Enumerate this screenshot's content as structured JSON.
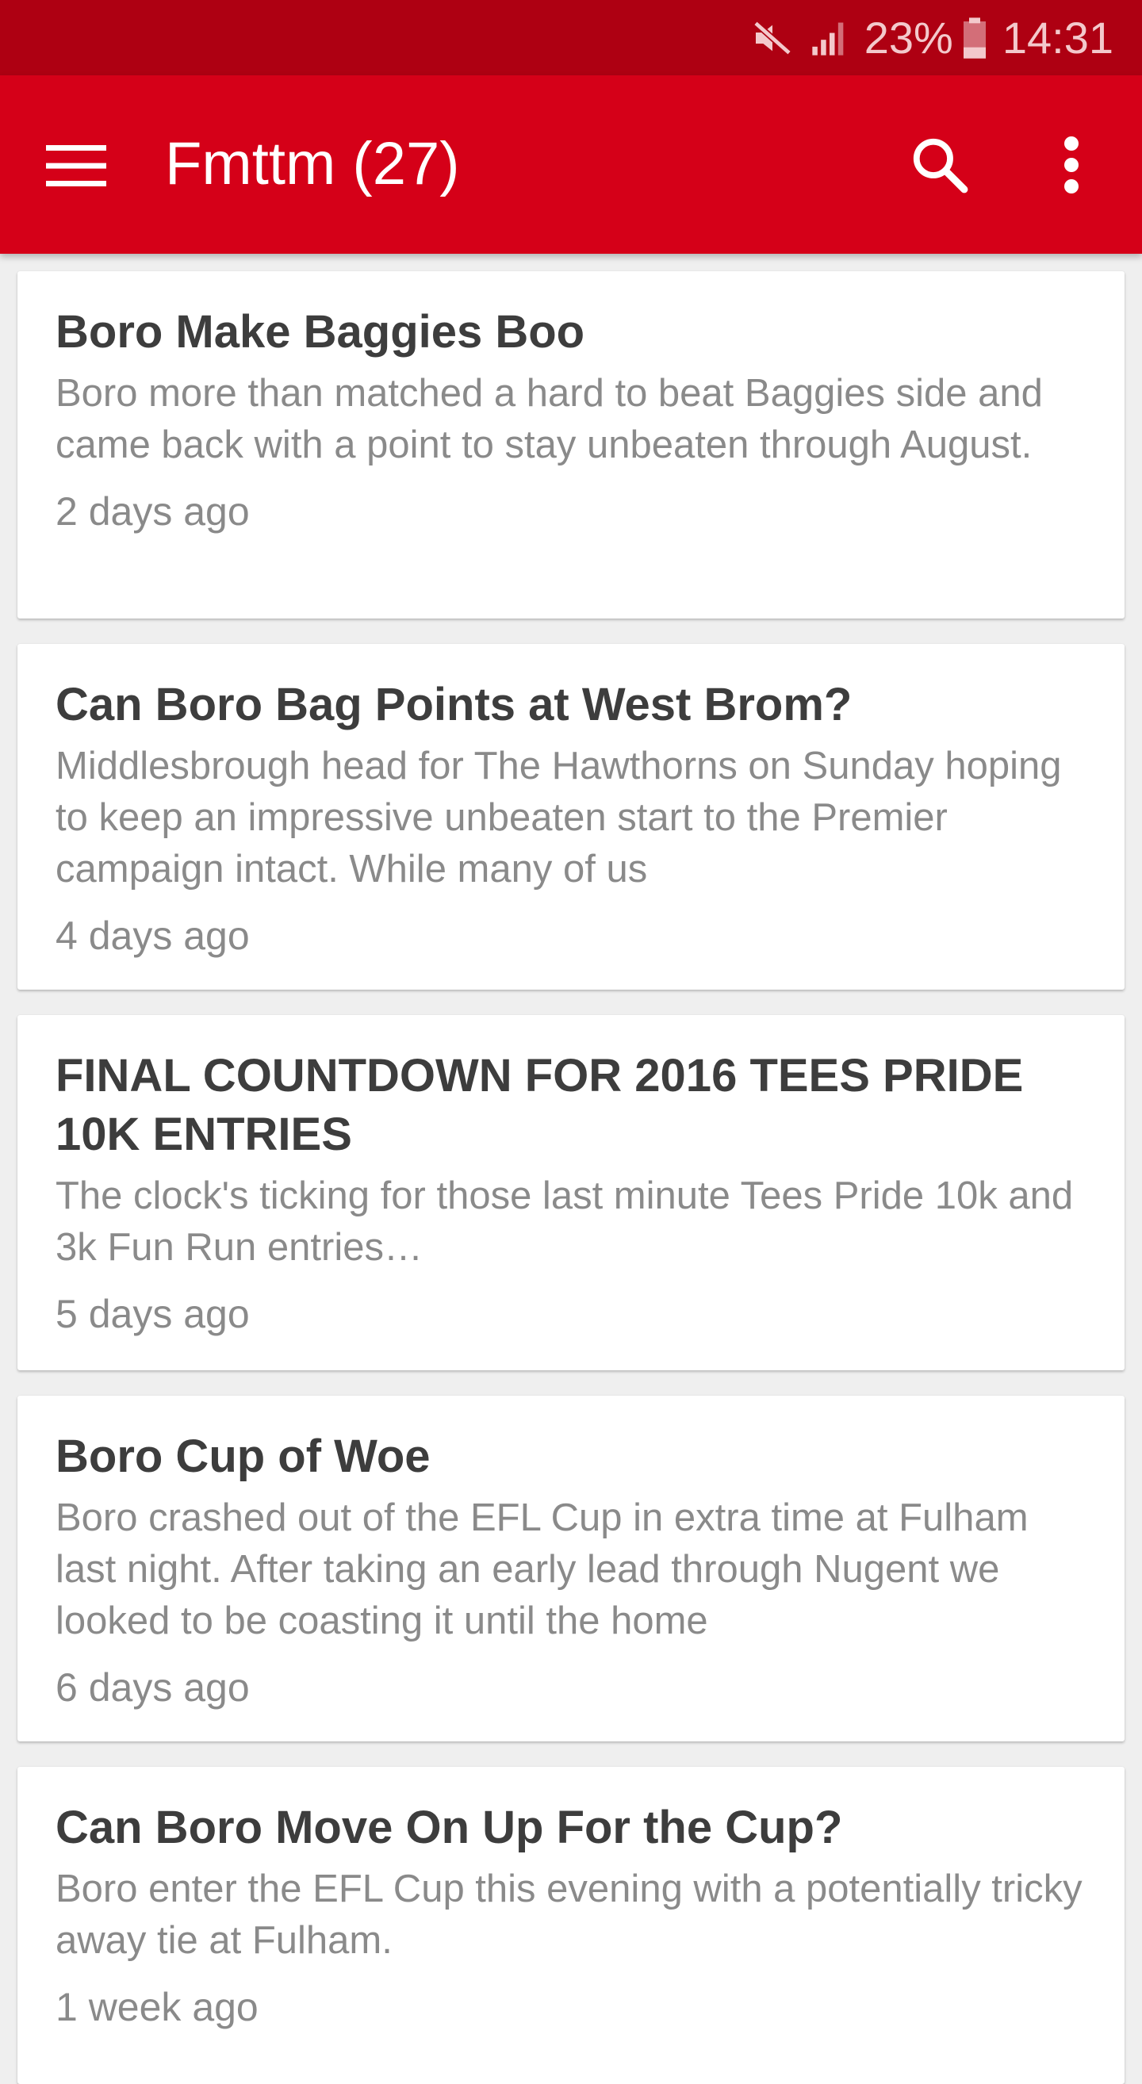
{
  "status_bar": {
    "battery_percent": "23%",
    "time": "14:31",
    "icons": [
      "mute-icon",
      "signal-icon",
      "battery-icon"
    ]
  },
  "app_bar": {
    "title": "Fmttm (27)",
    "icons": [
      "menu-icon",
      "search-icon",
      "more-vert-icon"
    ],
    "color": "#d50018",
    "status_color": "#ae0012"
  },
  "articles": [
    {
      "title": "Boro Make Baggies Boo",
      "excerpt": "Boro more than matched a hard to beat Baggies side and came back with a point to stay unbeaten through August.",
      "time": "2 days ago"
    },
    {
      "title": "Can Boro Bag Points at West Brom?",
      "excerpt": "Middlesbrough head for The Hawthorns on Sunday hoping to keep an impressive unbeaten start to the Premier campaign intact. While many of us",
      "time": "4 days ago"
    },
    {
      "title": "FINAL COUNTDOWN FOR 2016 TEES PRIDE 10K ENTRIES",
      "excerpt": "The clock's ticking for those last minute Tees Pride 10k and 3k Fun Run entries…",
      "time": "5 days ago"
    },
    {
      "title": "Boro Cup of Woe",
      "excerpt": "Boro crashed out of the EFL Cup in extra time at Fulham last night. After taking an early lead through Nugent we looked to be coasting it until the home",
      "time": "6 days ago"
    },
    {
      "title": "Can Boro Move On Up For the Cup?",
      "excerpt": "Boro enter the EFL Cup this evening with a potentially tricky away tie at Fulham.",
      "time": "1 week ago"
    }
  ]
}
